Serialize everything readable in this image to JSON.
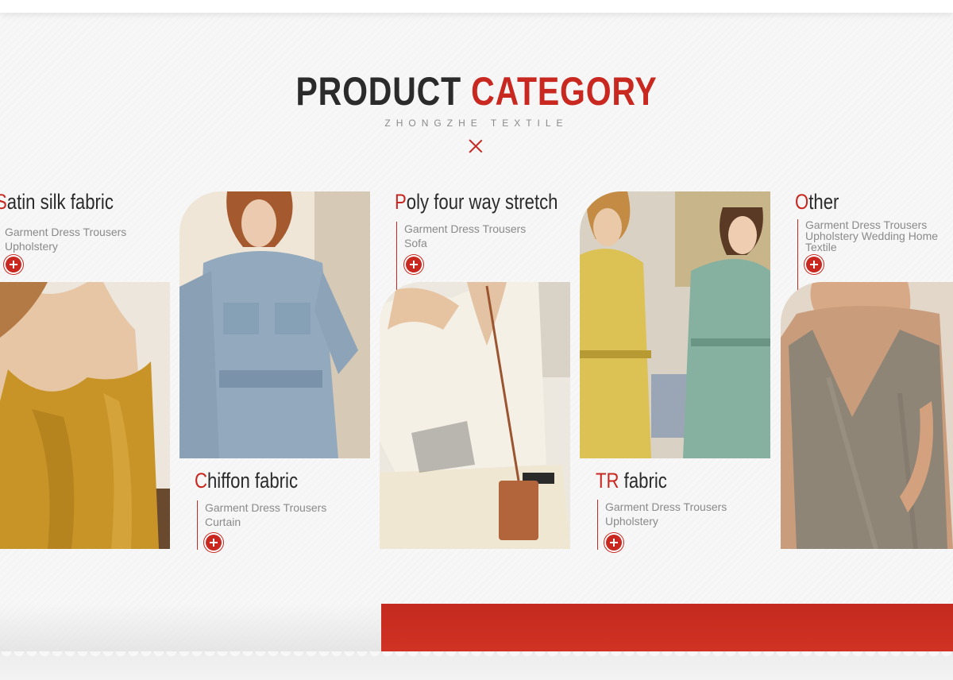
{
  "header": {
    "title_part1": "PRODUCT",
    "title_part2": "CATEGORY",
    "subtitle": "ZHONGZHE TEXTILE"
  },
  "categories": [
    {
      "initial": "S",
      "rest": "atin silk fabric",
      "line1": "Garment Dress Trousers",
      "line2": "Upholstery"
    },
    {
      "initial": "C",
      "rest": "hiffon fabric",
      "line1": "Garment Dress Trousers",
      "line2": "Curtain"
    },
    {
      "initial": "P",
      "rest": "oly four way stretch",
      "line1": "Garment Dress Trousers",
      "line2": "Sofa"
    },
    {
      "initial": "TR",
      "rest": " fabric",
      "line1": "Garment Dress Trousers",
      "line2": "Upholstery"
    },
    {
      "initial": "O",
      "rest": "ther",
      "line1": "Garment Dress Trousers",
      "line2": "Upholstery Wedding Home",
      "line3": "Textile"
    }
  ],
  "colors": {
    "accent": "#c8281f",
    "title": "#2b2b2b",
    "text": "#8a8a8a"
  },
  "icons": [
    "close-x-icon",
    "plus-circle-icon"
  ]
}
